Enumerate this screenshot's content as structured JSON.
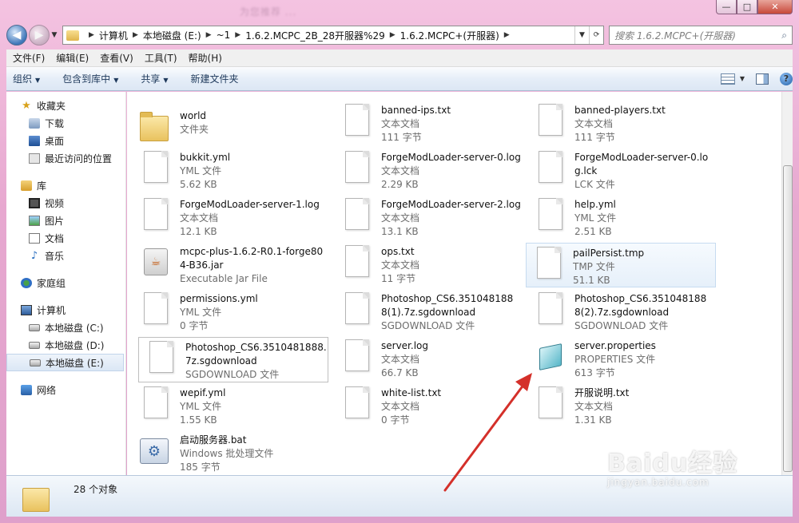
{
  "window": {
    "blurred_title": "为您推荐 ...",
    "minimize_glyph": "—",
    "maximize_glyph": "□",
    "close_glyph": "✕"
  },
  "address": {
    "crumbs": [
      "计算机",
      "本地磁盘 (E:)",
      "~1",
      "1.6.2.MCPC_2B_28开服器%29",
      "1.6.2.MCPC+(开服器)"
    ],
    "search_placeholder": "搜索 1.6.2.MCPC+(开服器)"
  },
  "menu": [
    "文件(F)",
    "编辑(E)",
    "查看(V)",
    "工具(T)",
    "帮助(H)"
  ],
  "commands": [
    "组织",
    "包含到库中",
    "共享",
    "新建文件夹"
  ],
  "nav": {
    "favorites": "收藏夹",
    "downloads": "下载",
    "desktop": "桌面",
    "recent": "最近访问的位置",
    "libraries": "库",
    "videos": "视频",
    "pictures": "图片",
    "documents": "文档",
    "music": "音乐",
    "homegroup": "家庭组",
    "computer": "计算机",
    "drive_c": "本地磁盘 (C:)",
    "drive_d": "本地磁盘 (D:)",
    "drive_e": "本地磁盘 (E:)",
    "network": "网络"
  },
  "files": [
    {
      "name": "world",
      "type": "文件夹",
      "size": ""
    },
    {
      "name": "banned-ips.txt",
      "type": "文本文档",
      "size": "111 字节"
    },
    {
      "name": "banned-players.txt",
      "type": "文本文档",
      "size": "111 字节"
    },
    {
      "name": "bukkit.yml",
      "type": "YML 文件",
      "size": "5.62 KB"
    },
    {
      "name": "ForgeModLoader-server-0.log",
      "type": "文本文档",
      "size": "2.29 KB"
    },
    {
      "name": "ForgeModLoader-server-0.log.lck",
      "type": "LCK 文件",
      "size": ""
    },
    {
      "name": "ForgeModLoader-server-1.log",
      "type": "文本文档",
      "size": "12.1 KB"
    },
    {
      "name": "ForgeModLoader-server-2.log",
      "type": "文本文档",
      "size": "13.1 KB"
    },
    {
      "name": "help.yml",
      "type": "YML 文件",
      "size": "2.51 KB"
    },
    {
      "name": "mcpc-plus-1.6.2-R0.1-forge804-B36.jar",
      "type": "Executable Jar File",
      "size": ""
    },
    {
      "name": "ops.txt",
      "type": "文本文档",
      "size": "11 字节"
    },
    {
      "name": "pailPersist.tmp",
      "type": "TMP 文件",
      "size": "51.1 KB"
    },
    {
      "name": "permissions.yml",
      "type": "YML 文件",
      "size": "0 字节"
    },
    {
      "name": "Photoshop_CS6.3510481888(1).7z.sgdownload",
      "type": "SGDOWNLOAD 文件",
      "size": ""
    },
    {
      "name": "Photoshop_CS6.3510481888(2).7z.sgdownload",
      "type": "SGDOWNLOAD 文件",
      "size": ""
    },
    {
      "name": "Photoshop_CS6.3510481888.7z.sgdownload",
      "type": "SGDOWNLOAD 文件",
      "size": ""
    },
    {
      "name": "server.log",
      "type": "文本文档",
      "size": "66.7 KB"
    },
    {
      "name": "server.properties",
      "type": "PROPERTIES 文件",
      "size": "613 字节"
    },
    {
      "name": "wepif.yml",
      "type": "YML 文件",
      "size": "1.55 KB"
    },
    {
      "name": "white-list.txt",
      "type": "文本文档",
      "size": "0 字节"
    },
    {
      "name": "开服说明.txt",
      "type": "文本文档",
      "size": "1.31 KB"
    },
    {
      "name": "启动服务器.bat",
      "type": "Windows 批处理文件",
      "size": "185 字节"
    }
  ],
  "status": {
    "count": "28 个对象"
  },
  "watermark": {
    "brand": "Baidu经验",
    "url": "jingyan.baidu.com"
  },
  "colors": {
    "arrow": "#d4302a",
    "frame": "#e7a8d0",
    "command_bar": "#dce7f4"
  }
}
